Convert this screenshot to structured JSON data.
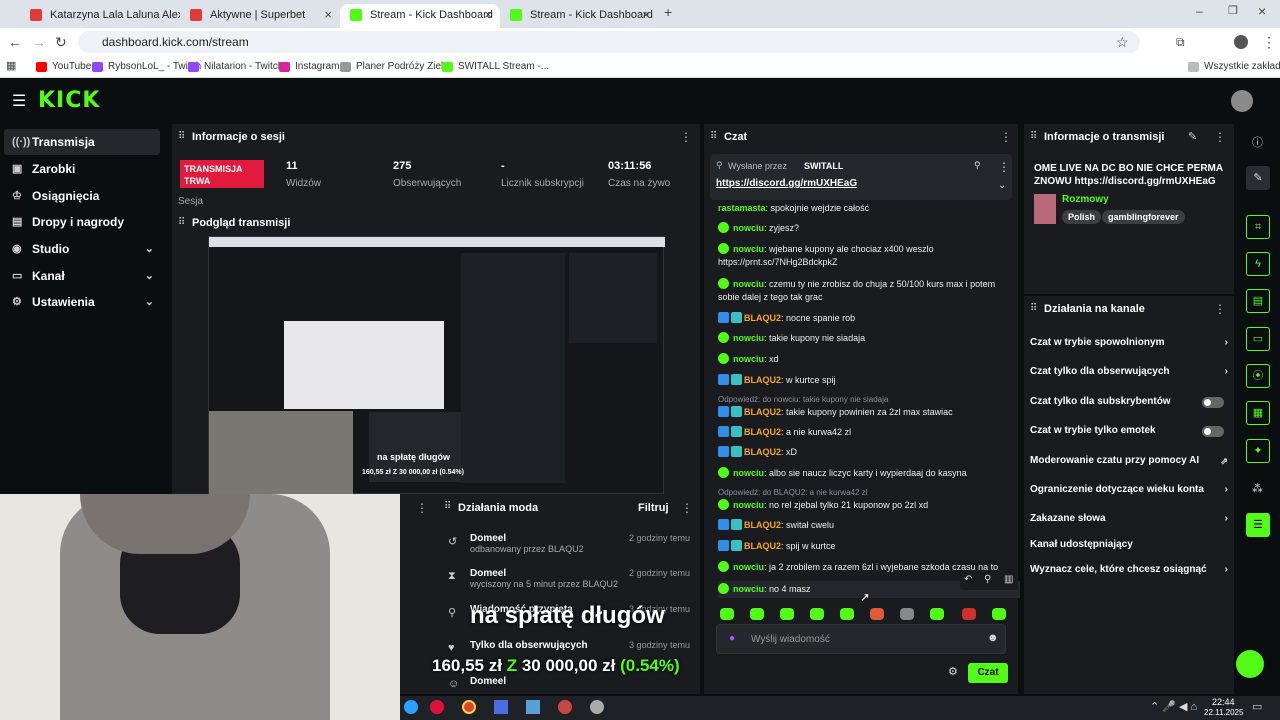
{
  "tabs": [
    {
      "label": "Katarzyna Lala Laluna Alexande",
      "color": "#e03b3b"
    },
    {
      "label": "Aktywne | Superbet",
      "color": "#e03b3b"
    },
    {
      "label": "Stream - Kick Dashboard",
      "color": "#53fc18"
    },
    {
      "label": "Stream - Kick Dashboard",
      "color": "#53fc18"
    }
  ],
  "url": "dashboard.kick.com/stream",
  "bookmarks": [
    "YouTube",
    "RybsonLoL_ - Twitch",
    "Nilatarion - Twitch",
    "Instagram",
    "Planer Podróży Ziel...",
    "SWITALL Stream -...",
    "Wszystkie zakładki"
  ],
  "brand": {
    "logo": "KICK",
    "accent": "#53fc18"
  },
  "sidebar": {
    "items": [
      {
        "label": "Transmisja",
        "icon": "broadcast-icon"
      },
      {
        "label": "Zarobki",
        "icon": "wallet-icon"
      },
      {
        "label": "Osiągnięcia",
        "icon": "trophy-icon"
      },
      {
        "label": "Dropy i nagrody",
        "icon": "gift-icon"
      },
      {
        "label": "Studio",
        "icon": "studio-icon"
      },
      {
        "label": "Kanał",
        "icon": "channel-icon"
      },
      {
        "label": "Ustawienia",
        "icon": "gear-icon"
      }
    ]
  },
  "session": {
    "title": "Informacje o sesji",
    "status": "TRANSMISJA TRWA",
    "status_label": "Sesja",
    "viewers": "11",
    "viewers_label": "Widzów",
    "followers": "275",
    "followers_label": "Obserwujących",
    "subs": "-",
    "subs_label": "Licznik subskrypcji",
    "time": "03:11:56",
    "time_label": "Czas na żywo"
  },
  "preview": {
    "title": "Podgląd transmisji",
    "caption": "na spłatę długów",
    "mini": "160,55 zł Z 30 000,00 zł (0.54%)"
  },
  "mod": {
    "title": "Działania moda",
    "filter": "Filtruj",
    "rows": [
      {
        "name": "Domeel",
        "desc": "odbanowany przez BLAQU2",
        "time": "2 godziny temu",
        "icon": "undo-icon"
      },
      {
        "name": "Domeel",
        "desc": "wyciszony na 5 minut przez BLAQU2",
        "time": "2 godziny temu",
        "icon": "hourglass-icon"
      },
      {
        "name": "Wiadomość przypięta",
        "desc": "",
        "time": "3 godziny temu",
        "icon": "pin-icon"
      },
      {
        "name": "Tylko dla obserwujących",
        "desc": "",
        "time": "3 godziny temu",
        "icon": "heart-icon"
      },
      {
        "name": "Domeel",
        "desc": "",
        "time": "",
        "icon": "user-icon"
      }
    ]
  },
  "overlay": {
    "caption": "na spłatę długów",
    "progress_a": "160,55 zł",
    "progress_z": "Z",
    "progress_b": "30 000,00 zł",
    "progress_pct": "(0.54%)"
  },
  "chat": {
    "title": "Czat",
    "pinned_by": "Wysłane przez",
    "pinned_user": "SWITALL",
    "pinned_link": "https://discord.gg/rmUXHEaG",
    "messages": [
      {
        "user": "rastamasta",
        "badge": "none",
        "text": "spokojnie wejdzie całość"
      },
      {
        "user": "nowciu",
        "badge": "g",
        "text": "zyjesz?"
      },
      {
        "user": "nowciu",
        "badge": "g",
        "text": "wjebane kupony ale chociaz x400 weszlo https://prnt.sc/7NHg2BdckpkZ"
      },
      {
        "user": "nowciu",
        "badge": "g",
        "text": "czemu ty nie zrobisz do chuja z 50/100 kurs max i potem sobie dalej z tego tak grac"
      },
      {
        "user": "BLAQU2",
        "badge": "b",
        "text": "nocne spanie rob"
      },
      {
        "user": "nowciu",
        "badge": "g",
        "text": "takie kupony nie siadaja"
      },
      {
        "user": "nowciu",
        "badge": "g",
        "text": "xd"
      },
      {
        "user": "BLAQU2",
        "badge": "b",
        "text": "w kurtce spij"
      },
      {
        "user": "BLAQU2",
        "badge": "b",
        "reply": "Odpowiedź: do nowciu: takie kupony nie siadaja",
        "text": "takie kupony powinien za 2zl max stawiac"
      },
      {
        "user": "BLAQU2",
        "badge": "b",
        "text": "a nie kurwa42 zl"
      },
      {
        "user": "BLAQU2",
        "badge": "b",
        "text": "xD"
      },
      {
        "user": "nowciu",
        "badge": "g",
        "text": "albo sie naucz liczyc karty i wypierdaaj do kasyna"
      },
      {
        "user": "nowciu",
        "badge": "g",
        "reply": "Odpowiedź: do BLAQU2: a nie kurwa42 zl",
        "text": "no rel zjebal tylko 21 kuponow po 2zl xd"
      },
      {
        "user": "BLAQU2",
        "badge": "b",
        "text": "switał cwelu"
      },
      {
        "user": "BLAQU2",
        "badge": "b",
        "text": "spij w kurtce"
      },
      {
        "user": "nowciu",
        "badge": "g",
        "text": "ja 2 zrobilem za razem 6zl i wyjebane szkoda czasu na to"
      },
      {
        "user": "nowciu",
        "badge": "g",
        "text": "no 4 masz"
      }
    ],
    "input_placeholder": "Wyślij wiadomość",
    "send_label": "Czat"
  },
  "stream_info": {
    "title": "Informacje o transmisji",
    "stream_title": "OME LIVE NA DC BO NIE CHCE PERMA ZNOWU https://discord.gg/rmUXHEaG",
    "category": "Rozmowy",
    "tags": [
      "Polish",
      "gamblingforever"
    ]
  },
  "channel_actions": {
    "title": "Działania na kanale",
    "items": [
      {
        "label": "Czat w trybie spowolnionym",
        "type": "arrow"
      },
      {
        "label": "Czat tylko dla obserwujących",
        "type": "arrow"
      },
      {
        "label": "Czat tylko dla subskrybentów",
        "type": "toggle"
      },
      {
        "label": "Czat w trybie tylko emotek",
        "type": "toggle"
      },
      {
        "label": "Moderowanie czatu przy pomocy AI",
        "type": "chart"
      },
      {
        "label": "Ograniczenie dotyczące wieku konta",
        "type": "arrow"
      },
      {
        "label": "Zakazane słowa",
        "type": "arrow"
      },
      {
        "label": "Kanał udostępniający",
        "type": "none"
      },
      {
        "label": "Wyznacz cele, które chcesz osiągnąć",
        "type": "arrow"
      }
    ]
  },
  "taskbar": {
    "time": "22:44",
    "date": "22.11.2025"
  }
}
